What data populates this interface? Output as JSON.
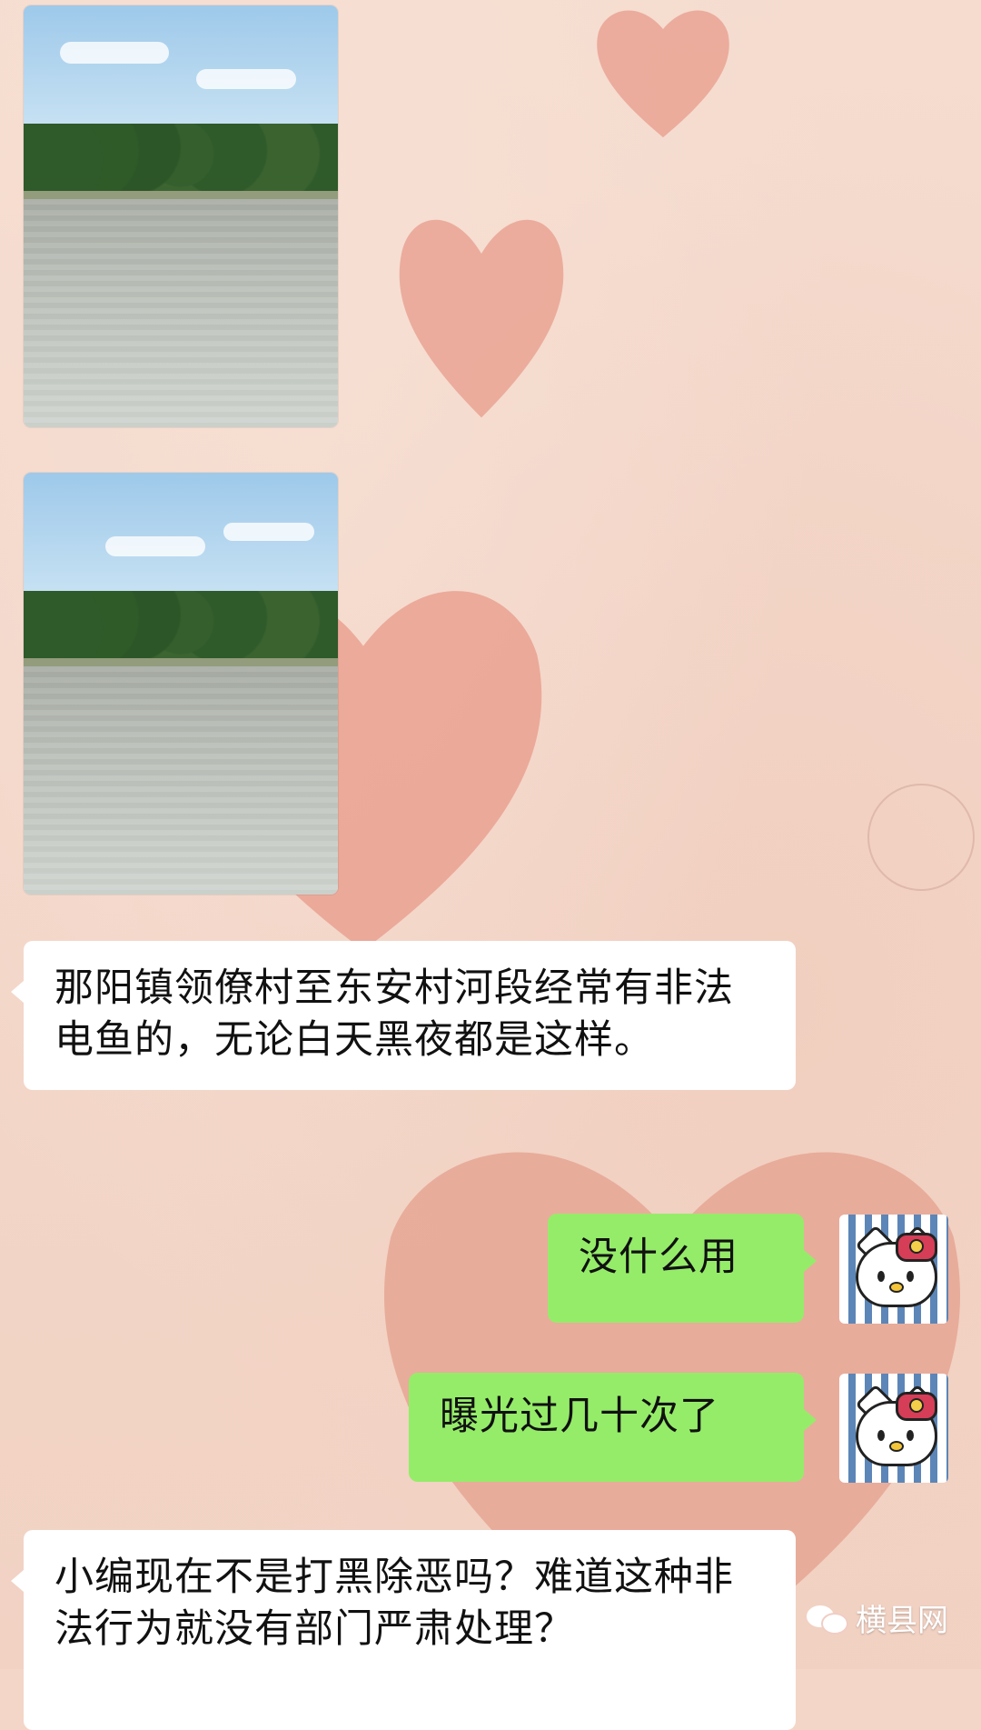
{
  "messages": [
    {
      "type": "image",
      "side": "left",
      "alt": "river photo 1"
    },
    {
      "type": "image",
      "side": "left",
      "alt": "river photo 2"
    },
    {
      "type": "text",
      "side": "left",
      "text": "那阳镇领僚村至东安村河段经常有非法电鱼的，无论白天黑夜都是这样。"
    },
    {
      "type": "text",
      "side": "right",
      "text": "没什么用"
    },
    {
      "type": "text",
      "side": "right",
      "text": "曝光过几十次了"
    },
    {
      "type": "text",
      "side": "left",
      "text": "小编现在不是打黑除恶吗？难道这种非法行为就没有部门严肃处理？"
    }
  ],
  "brand": {
    "name": "横县网"
  },
  "colors": {
    "chat_bg": "#f3d6c8",
    "bubble_left": "#ffffff",
    "bubble_right": "#95ec69"
  },
  "icons": {
    "avatar": "hello-kitty-avatar",
    "brand_logo": "wechat-logo-icon"
  }
}
